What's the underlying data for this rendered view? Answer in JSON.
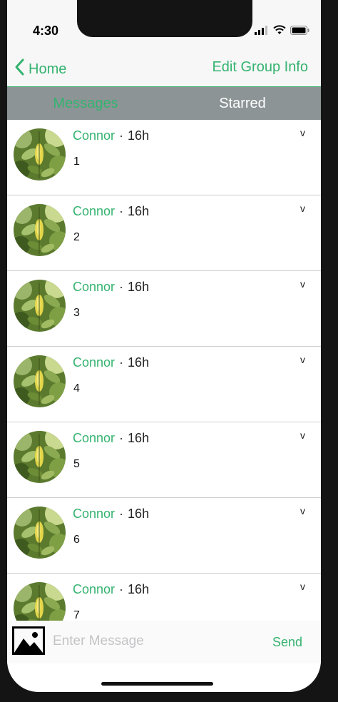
{
  "status_bar": {
    "time": "4:30"
  },
  "nav": {
    "back_label": "Home",
    "edit_label": "Edit Group Info"
  },
  "tabs": [
    {
      "label": "Messages"
    },
    {
      "label": "Starred"
    }
  ],
  "messages": [
    {
      "author": "Connor",
      "separator": "·",
      "time_ago": "16h",
      "text": "1",
      "chevron": "v"
    },
    {
      "author": "Connor",
      "separator": "·",
      "time_ago": "16h",
      "text": "2",
      "chevron": "v"
    },
    {
      "author": "Connor",
      "separator": "·",
      "time_ago": "16h",
      "text": "3",
      "chevron": "v"
    },
    {
      "author": "Connor",
      "separator": "·",
      "time_ago": "16h",
      "text": "4",
      "chevron": "v"
    },
    {
      "author": "Connor",
      "separator": "·",
      "time_ago": "16h",
      "text": "5",
      "chevron": "v"
    },
    {
      "author": "Connor",
      "separator": "·",
      "time_ago": "16h",
      "text": "6",
      "chevron": "v"
    },
    {
      "author": "Connor",
      "separator": "·",
      "time_ago": "16h",
      "text": "7",
      "chevron": "v"
    }
  ],
  "composer": {
    "placeholder": "Enter Message",
    "value": "",
    "send_label": "Send"
  },
  "icons": {
    "back": "chevron-left-icon",
    "photo": "photo-icon",
    "wifi": "wifi-icon",
    "signal": "signal-icon",
    "battery": "battery-icon",
    "avatar": "leaf-photo"
  },
  "colors": {
    "accent": "#34b36f",
    "tab_bar": "#8d9496",
    "placeholder": "#c4c4c7"
  }
}
